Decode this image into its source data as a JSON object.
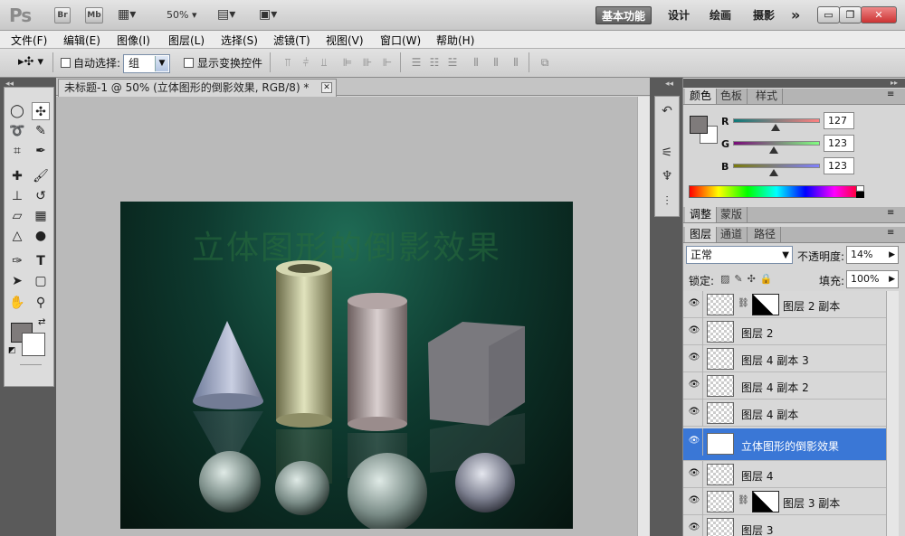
{
  "app": {
    "logo": "Ps",
    "bridge_label": "Br",
    "minibridge_label": "Mb",
    "zoom": "50%"
  },
  "workspaces": [
    "基本功能",
    "设计",
    "绘画",
    "摄影"
  ],
  "more_glyph": "»",
  "window_controls": [
    "▭",
    "❐",
    "✕"
  ],
  "menu": [
    "文件(F)",
    "编辑(E)",
    "图像(I)",
    "图层(L)",
    "选择(S)",
    "滤镜(T)",
    "视图(V)",
    "窗口(W)",
    "帮助(H)"
  ],
  "options": {
    "auto_select_label": "自动选择:",
    "auto_select_value": "组",
    "show_transform_label": "显示变换控件"
  },
  "document": {
    "tab_title": "未标题-1 @ 50% (立体图形的倒影效果, RGB/8) *",
    "canvas_text": "立体图形的倒影效果",
    "bg_color": "#0e3a2f"
  },
  "color_panel": {
    "tabs": [
      "颜色",
      "色板",
      "样式"
    ],
    "r_label": "R",
    "g_label": "G",
    "b_label": "B",
    "r": "127",
    "g": "123",
    "b": "123",
    "fg_color": "#7f7b7b",
    "bg_color": "#ffffff"
  },
  "adjust_tabs": [
    "调整",
    "蒙版"
  ],
  "layers_panel": {
    "tabs": [
      "图层",
      "通道",
      "路径"
    ],
    "blend_mode": "正常",
    "opacity_label": "不透明度:",
    "opacity": "14%",
    "lock_label": "锁定:",
    "fill_label": "填充:",
    "fill": "100%",
    "layers": [
      {
        "name": "图层 2 副本",
        "kind": "masked",
        "selected": false
      },
      {
        "name": "图层 2",
        "kind": "pixel",
        "selected": false
      },
      {
        "name": "图层 4 副本 3",
        "kind": "pixel",
        "selected": false
      },
      {
        "name": "图层 4 副本 2",
        "kind": "pixel",
        "selected": false
      },
      {
        "name": "图层 4 副本",
        "kind": "pixel",
        "selected": false
      },
      {
        "name": "立体图形的倒影效果",
        "kind": "text",
        "selected": true
      },
      {
        "name": "图层 4",
        "kind": "pixel",
        "selected": false
      },
      {
        "name": "图层 3 副本",
        "kind": "masked",
        "selected": false
      },
      {
        "name": "图层 3",
        "kind": "pixel",
        "selected": false
      }
    ]
  }
}
